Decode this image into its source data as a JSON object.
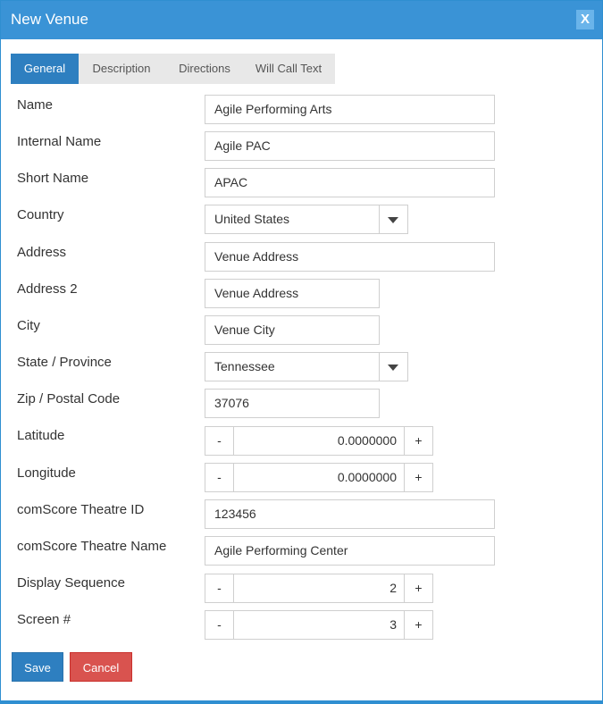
{
  "dialog": {
    "title": "New Venue",
    "close_label": "X"
  },
  "tabs": [
    {
      "label": "General",
      "active": true
    },
    {
      "label": "Description",
      "active": false
    },
    {
      "label": "Directions",
      "active": false
    },
    {
      "label": "Will Call Text",
      "active": false
    }
  ],
  "fields": {
    "name": {
      "label": "Name",
      "value": "Agile Performing Arts"
    },
    "internal_name": {
      "label": "Internal Name",
      "value": "Agile PAC"
    },
    "short_name": {
      "label": "Short Name",
      "value": "APAC"
    },
    "country": {
      "label": "Country",
      "value": "United States"
    },
    "address": {
      "label": "Address",
      "value": "Venue Address"
    },
    "address2": {
      "label": "Address 2",
      "value": "Venue Address"
    },
    "city": {
      "label": "City",
      "value": "Venue City"
    },
    "state": {
      "label": "State / Province",
      "value": "Tennessee"
    },
    "zip": {
      "label": "Zip / Postal Code",
      "value": "37076"
    },
    "latitude": {
      "label": "Latitude",
      "value": "0.0000000"
    },
    "longitude": {
      "label": "Longitude",
      "value": "0.0000000"
    },
    "comscore_id": {
      "label": "comScore Theatre ID",
      "value": "123456"
    },
    "comscore_name": {
      "label": "comScore Theatre Name",
      "value": "Agile Performing Center"
    },
    "display_sequence": {
      "label": "Display Sequence",
      "value": "2"
    },
    "screen": {
      "label": "Screen #",
      "value": "3"
    }
  },
  "stepper": {
    "minus": "-",
    "plus": "+"
  },
  "buttons": {
    "save": "Save",
    "cancel": "Cancel"
  },
  "colors": {
    "header": "#3a93d6",
    "primary": "#2e7fc0",
    "danger": "#d9534f"
  }
}
